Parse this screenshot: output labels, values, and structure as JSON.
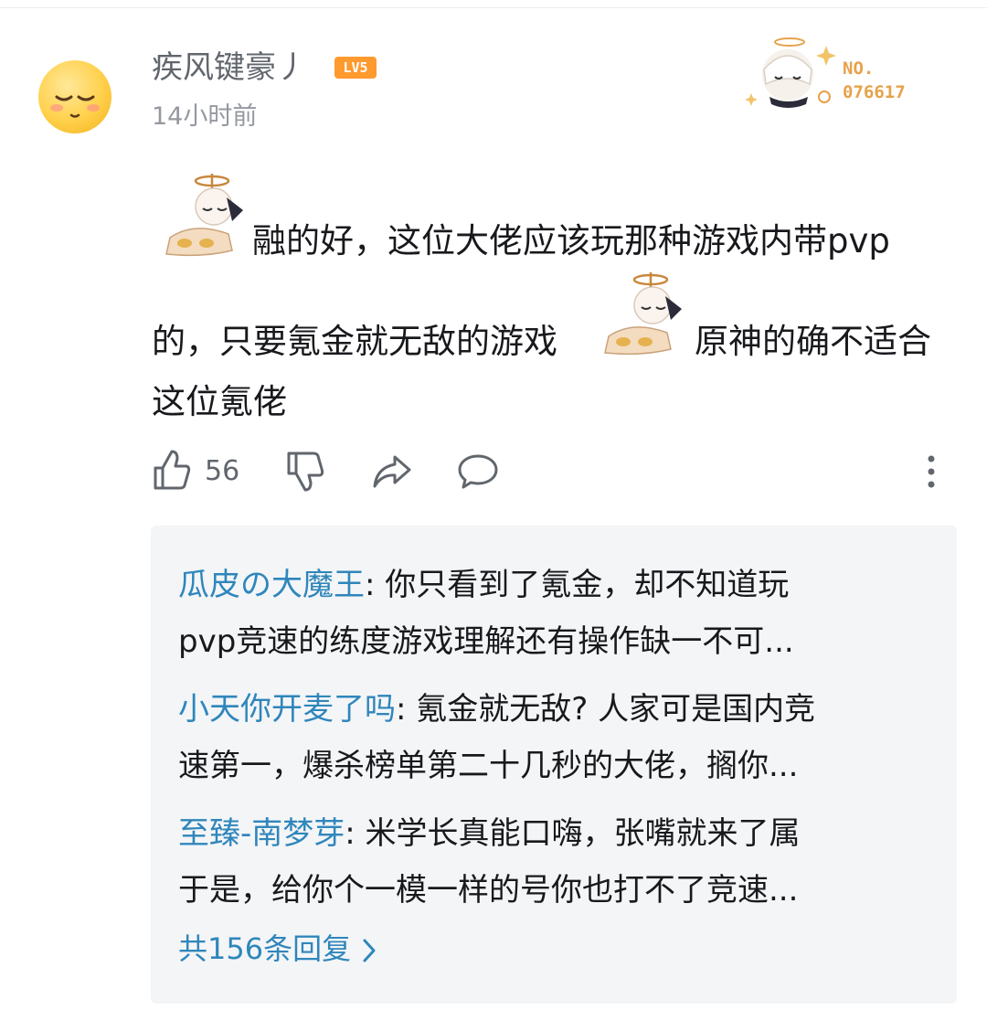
{
  "comment": {
    "username": "疾风键豪丿",
    "level": "LV5",
    "timestamp": "14小时前",
    "fan_badge": {
      "label": "NO.",
      "number": "076617"
    },
    "lines": [
      "融的好，这位大佬应该玩那种游戏内带pvp",
      "的，只要氪金就无敌的游戏",
      "原神的确不适合",
      "这位氪佬"
    ],
    "like_count": "56"
  },
  "replies": [
    {
      "name": "瓜皮の大魔王",
      "text_line1": ": 你只看到了氪金，却不知道玩",
      "text_line2": "pvp竞速的练度游戏理解还有操作缺一不可..."
    },
    {
      "name": "小天你开麦了吗",
      "text_line1": ": 氪金就无敌? 人家可是国内竞",
      "text_line2": "速第一，爆杀榜单第二十几秒的大佬，搁你..."
    },
    {
      "name": "至臻-南梦芽",
      "text_line1": ": 米学长真能口嗨，张嘴就来了属",
      "text_line2": "于是，给你个一模一样的号你也打不了竞速..."
    }
  ],
  "more_replies_label": "共156条回复",
  "colors": {
    "link": "#2f86bb",
    "badge": "#ff9a2e",
    "meta": "#9499a0"
  },
  "icons": [
    "like-icon",
    "dislike-icon",
    "share-icon",
    "reply-icon",
    "more-icon",
    "chevron-right-icon"
  ]
}
